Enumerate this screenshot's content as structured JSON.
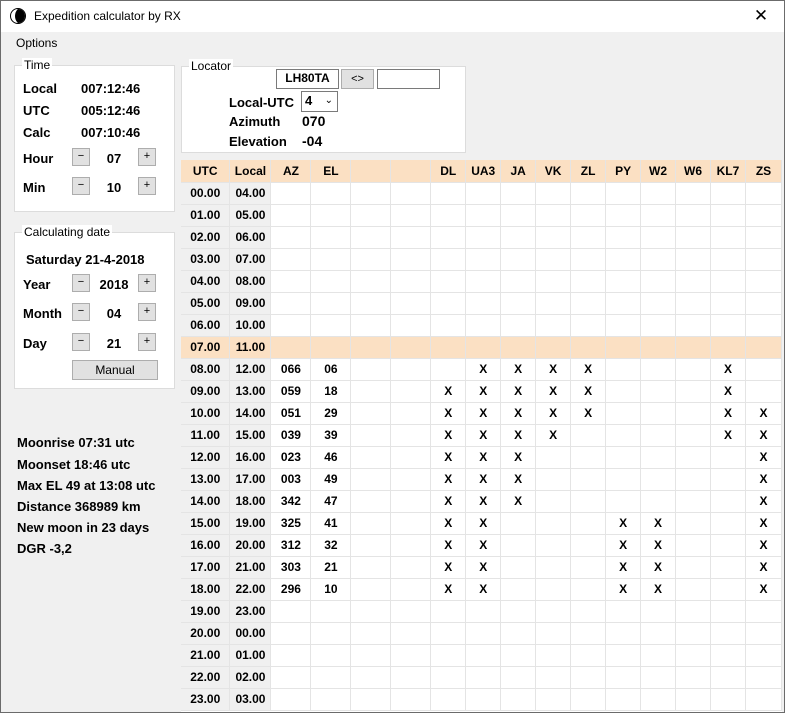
{
  "window": {
    "title": "Expedition calculator by RX",
    "close_glyph": "✕"
  },
  "menu": {
    "options": "Options"
  },
  "time": {
    "legend": "Time",
    "local_label": "Local",
    "local_value": "007:12:46",
    "utc_label": "UTC",
    "utc_value": "005:12:46",
    "calc_label": "Calc",
    "calc_value": "007:10:46",
    "hour_label": "Hour",
    "hour_value": "07",
    "min_label": "Min",
    "min_value": "10",
    "minus": "−",
    "plus": "+"
  },
  "calcdate": {
    "legend": "Calculating date",
    "date_text": "Saturday 21-4-2018",
    "year_label": "Year",
    "year_value": "2018",
    "month_label": "Month",
    "month_value": "04",
    "day_label": "Day",
    "day_value": "21",
    "manual_label": "Manual"
  },
  "moon": {
    "moonrise": "Moonrise 07:31 utc",
    "moonset": "Moonset 18:46 utc",
    "max_el": "Max EL 49 at 13:08 utc",
    "distance": "Distance 368989 km",
    "new_moon": "New moon in 23 days",
    "dgr": "DGR -3,2"
  },
  "locator": {
    "legend": "Locator",
    "locator_value": "LH80TA",
    "swap_label": "<>",
    "second_value": "",
    "local_utc_label": "Local-UTC",
    "local_utc_value": "4",
    "azimuth_label": "Azimuth",
    "azimuth_value": "070",
    "elevation_label": "Elevation",
    "elevation_value": "-04"
  },
  "table": {
    "headers": [
      "UTC",
      "Local",
      "AZ",
      "EL",
      "",
      "",
      "DL",
      "UA3",
      "JA",
      "VK",
      "ZL",
      "PY",
      "W2",
      "W6",
      "KL7",
      "ZS"
    ],
    "highlight_row": 7,
    "rows": [
      [
        "00.00",
        "04.00",
        "",
        "",
        "",
        "",
        "",
        "",
        "",
        "",
        "",
        "",
        "",
        "",
        "",
        ""
      ],
      [
        "01.00",
        "05.00",
        "",
        "",
        "",
        "",
        "",
        "",
        "",
        "",
        "",
        "",
        "",
        "",
        "",
        ""
      ],
      [
        "02.00",
        "06.00",
        "",
        "",
        "",
        "",
        "",
        "",
        "",
        "",
        "",
        "",
        "",
        "",
        "",
        ""
      ],
      [
        "03.00",
        "07.00",
        "",
        "",
        "",
        "",
        "",
        "",
        "",
        "",
        "",
        "",
        "",
        "",
        "",
        ""
      ],
      [
        "04.00",
        "08.00",
        "",
        "",
        "",
        "",
        "",
        "",
        "",
        "",
        "",
        "",
        "",
        "",
        "",
        ""
      ],
      [
        "05.00",
        "09.00",
        "",
        "",
        "",
        "",
        "",
        "",
        "",
        "",
        "",
        "",
        "",
        "",
        "",
        ""
      ],
      [
        "06.00",
        "10.00",
        "",
        "",
        "",
        "",
        "",
        "",
        "",
        "",
        "",
        "",
        "",
        "",
        "",
        ""
      ],
      [
        "07.00",
        "11.00",
        "",
        "",
        "",
        "",
        "",
        "",
        "",
        "",
        "",
        "",
        "",
        "",
        "",
        ""
      ],
      [
        "08.00",
        "12.00",
        "066",
        "06",
        "",
        "",
        "",
        "X",
        "X",
        "X",
        "X",
        "",
        "",
        "",
        "X",
        ""
      ],
      [
        "09.00",
        "13.00",
        "059",
        "18",
        "",
        "",
        "X",
        "X",
        "X",
        "X",
        "X",
        "",
        "",
        "",
        "X",
        ""
      ],
      [
        "10.00",
        "14.00",
        "051",
        "29",
        "",
        "",
        "X",
        "X",
        "X",
        "X",
        "X",
        "",
        "",
        "",
        "X",
        "X"
      ],
      [
        "11.00",
        "15.00",
        "039",
        "39",
        "",
        "",
        "X",
        "X",
        "X",
        "X",
        "",
        "",
        "",
        "",
        "X",
        "X"
      ],
      [
        "12.00",
        "16.00",
        "023",
        "46",
        "",
        "",
        "X",
        "X",
        "X",
        "",
        "",
        "",
        "",
        "",
        "",
        "X"
      ],
      [
        "13.00",
        "17.00",
        "003",
        "49",
        "",
        "",
        "X",
        "X",
        "X",
        "",
        "",
        "",
        "",
        "",
        "",
        "X"
      ],
      [
        "14.00",
        "18.00",
        "342",
        "47",
        "",
        "",
        "X",
        "X",
        "X",
        "",
        "",
        "",
        "",
        "",
        "",
        "X"
      ],
      [
        "15.00",
        "19.00",
        "325",
        "41",
        "",
        "",
        "X",
        "X",
        "",
        "",
        "",
        "X",
        "X",
        "",
        "",
        "X"
      ],
      [
        "16.00",
        "20.00",
        "312",
        "32",
        "",
        "",
        "X",
        "X",
        "",
        "",
        "",
        "X",
        "X",
        "",
        "",
        "X"
      ],
      [
        "17.00",
        "21.00",
        "303",
        "21",
        "",
        "",
        "X",
        "X",
        "",
        "",
        "",
        "X",
        "X",
        "",
        "",
        "X"
      ],
      [
        "18.00",
        "22.00",
        "296",
        "10",
        "",
        "",
        "X",
        "X",
        "",
        "",
        "",
        "X",
        "X",
        "",
        "",
        "X"
      ],
      [
        "19.00",
        "23.00",
        "",
        "",
        "",
        "",
        "",
        "",
        "",
        "",
        "",
        "",
        "",
        "",
        "",
        ""
      ],
      [
        "20.00",
        "00.00",
        "",
        "",
        "",
        "",
        "",
        "",
        "",
        "",
        "",
        "",
        "",
        "",
        "",
        ""
      ],
      [
        "21.00",
        "01.00",
        "",
        "",
        "",
        "",
        "",
        "",
        "",
        "",
        "",
        "",
        "",
        "",
        "",
        ""
      ],
      [
        "22.00",
        "02.00",
        "",
        "",
        "",
        "",
        "",
        "",
        "",
        "",
        "",
        "",
        "",
        "",
        "",
        ""
      ],
      [
        "23.00",
        "03.00",
        "",
        "",
        "",
        "",
        "",
        "",
        "",
        "",
        "",
        "",
        "",
        "",
        "",
        ""
      ]
    ]
  }
}
